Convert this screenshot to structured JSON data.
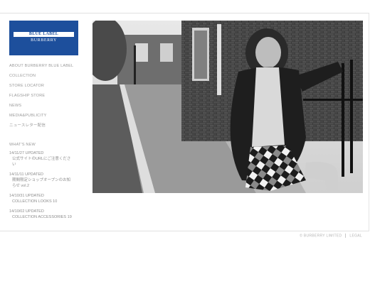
{
  "logo": {
    "line1": "BLUE LABEL",
    "line2": "BURBERRY",
    "color": "#1d4f9c"
  },
  "nav": [
    "ABOUT BURBERRY BLUE LABEL",
    "COLLECTION",
    "STORE LOCATOR",
    "FLAGSHIP STORE",
    "NEWS",
    "MEDIA&PUBLICITY",
    "ニュースレター配信"
  ],
  "whats_new": {
    "heading": "WHAT'S NEW",
    "items": [
      {
        "date": "14/11/27 UPDATED",
        "title": "公式サイトのURLにご注意くださ\nい"
      },
      {
        "date": "14/11/11 UPDATED",
        "title": "期間限定ショップオープンのお知\nらせ vol.2"
      },
      {
        "date": "14/10/31 UPDATED",
        "title": "COLLECTION LOOKS 10"
      },
      {
        "date": "14/10/02 UPDATED",
        "title": "COLLECTION ACCESSORIES 19"
      }
    ]
  },
  "footer": {
    "copyright": "© BURBERRY LIMITED",
    "legal": "LEGAL"
  }
}
